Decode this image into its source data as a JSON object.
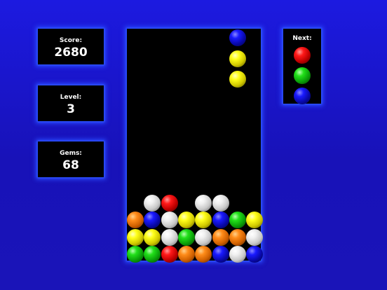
{
  "score": {
    "label": "Score:",
    "value": "2680"
  },
  "level": {
    "label": "Level:",
    "value": "3"
  },
  "gems": {
    "label": "Gems:",
    "value": "68"
  },
  "next": {
    "label": "Next:",
    "colors": [
      "red",
      "green",
      "blue"
    ]
  },
  "falling_piece": {
    "column": 6,
    "top_row": 0,
    "colors": [
      "blue",
      "yellow",
      "yellow"
    ]
  },
  "board": {
    "columns": 8,
    "rows": 14,
    "stack": [
      [
        null,
        null,
        null,
        null,
        null,
        null,
        null,
        null
      ],
      [
        null,
        null,
        null,
        null,
        null,
        null,
        null,
        null
      ],
      [
        null,
        null,
        null,
        null,
        null,
        null,
        null,
        null
      ],
      [
        null,
        null,
        null,
        null,
        null,
        null,
        null,
        null
      ],
      [
        null,
        null,
        null,
        null,
        null,
        null,
        null,
        null
      ],
      [
        null,
        null,
        null,
        null,
        null,
        null,
        null,
        null
      ],
      [
        null,
        null,
        null,
        null,
        null,
        null,
        null,
        null
      ],
      [
        null,
        null,
        null,
        null,
        null,
        null,
        null,
        null
      ],
      [
        null,
        null,
        null,
        null,
        null,
        null,
        null,
        null
      ],
      [
        null,
        null,
        null,
        null,
        null,
        null,
        null,
        null
      ],
      [
        null,
        "white",
        "red",
        null,
        "white",
        "white",
        null,
        null
      ],
      [
        "orange",
        "blue",
        "white",
        "yellow",
        "yellow",
        "blue",
        "green",
        "yellow"
      ],
      [
        "yellow",
        "yellow",
        "white",
        "green",
        "white",
        "orange",
        "orange",
        "white"
      ],
      [
        "green",
        "green",
        "red",
        "orange",
        "orange",
        "blue",
        "white",
        "blue"
      ]
    ]
  },
  "colors": {
    "background": "#1a16d0",
    "panel": "#000000",
    "glow": "#2a4cff",
    "text": "#ffffff"
  }
}
